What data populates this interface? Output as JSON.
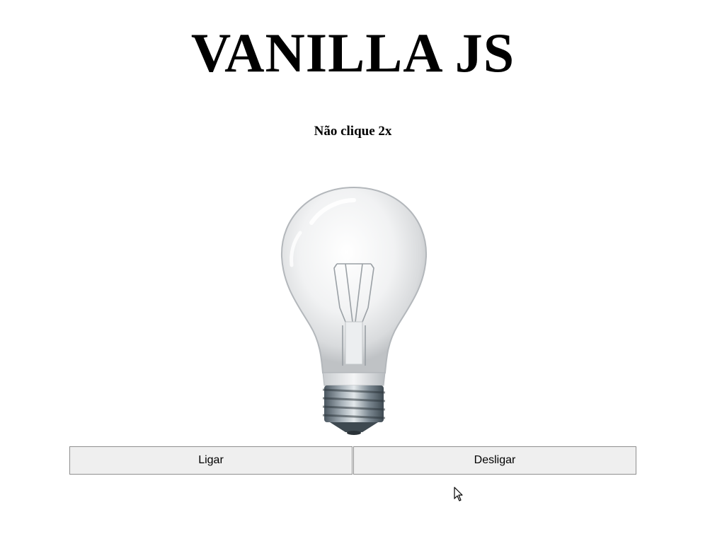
{
  "header": {
    "title": "VANILLA JS",
    "subtitle": "Não clique 2x"
  },
  "lamp": {
    "icon": "light-bulb-icon",
    "state": "off"
  },
  "controls": {
    "on_label": "Ligar",
    "off_label": "Desligar"
  },
  "colors": {
    "page_background": "#ffffff",
    "button_background": "#efefef",
    "button_border": "#8f8f8f"
  }
}
